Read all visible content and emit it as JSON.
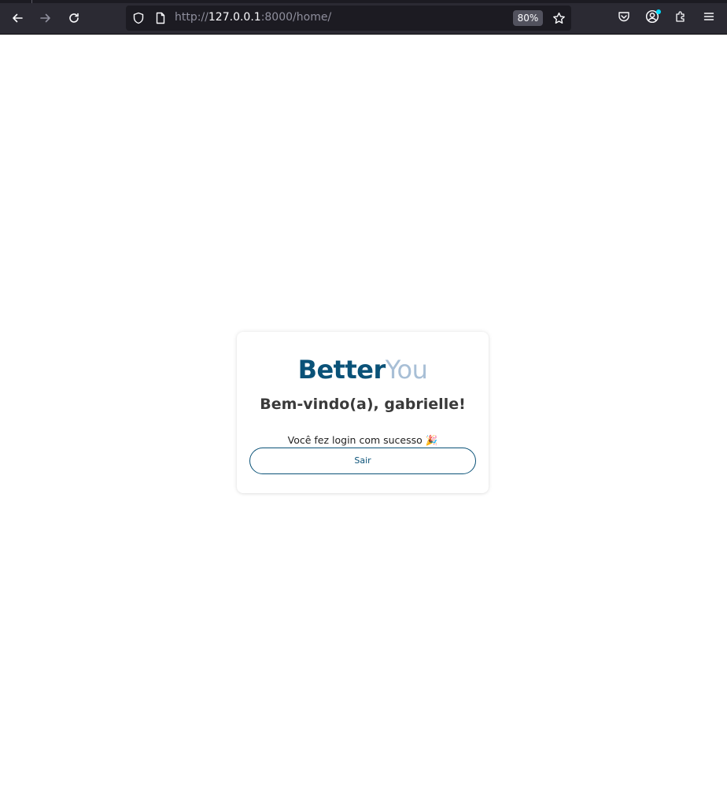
{
  "browser": {
    "url_scheme": "http://",
    "url_host": "127.0.0.1",
    "url_rest": ":8000/home/",
    "zoom": "80%",
    "colors": {
      "toolbar_bg": "#2b2a33",
      "urlbar_bg": "#1c1b22",
      "icon": "#fbfbfe",
      "icon_disabled": "#8f8f9d",
      "notification_dot": "#00ddff"
    },
    "icons": {
      "back": "arrow-left-icon",
      "forward": "arrow-right-icon",
      "reload": "reload-icon",
      "tracking": "shield-icon",
      "page": "page-icon",
      "bookmark": "star-icon",
      "pocket": "pocket-icon",
      "account": "account-icon",
      "extensions": "puzzle-icon",
      "menu": "hamburger-menu-icon"
    }
  },
  "page": {
    "brand_part1": "Better",
    "brand_part2": "You",
    "welcome": "Bem-vindo(a), gabrielle!",
    "success_message": "Você fez login com sucesso 🎉",
    "logout_label": "Sair",
    "colors": {
      "brand_primary": "#0a5278",
      "brand_secondary": "#a8bfd6",
      "heading": "#3a3a3a"
    }
  }
}
